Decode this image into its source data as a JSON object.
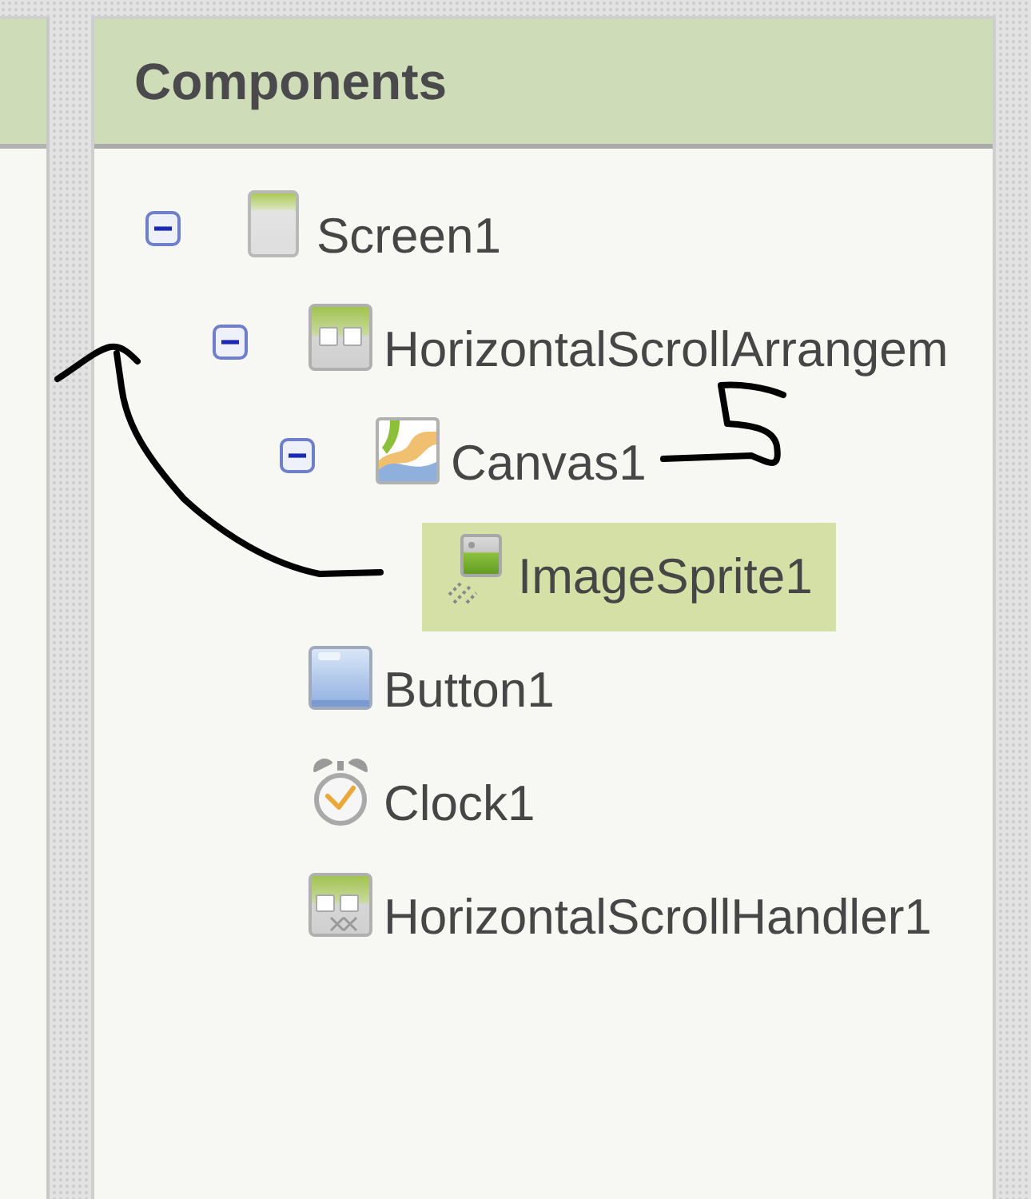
{
  "panel": {
    "title": "Components"
  },
  "tree": [
    {
      "kind": "screen",
      "label": "Screen1",
      "expanded": true,
      "selected": false,
      "children": [
        {
          "kind": "arrangement",
          "label": "HorizontalScrollArrangem",
          "expanded": true,
          "selected": false,
          "children": [
            {
              "kind": "canvas",
              "label": "Canvas1",
              "expanded": true,
              "selected": false,
              "children": [
                {
                  "kind": "sprite",
                  "label": "ImageSprite1",
                  "selected": true
                }
              ]
            }
          ]
        },
        {
          "kind": "button",
          "label": "Button1",
          "selected": false
        },
        {
          "kind": "clock",
          "label": "Clock1",
          "selected": false
        },
        {
          "kind": "scroll_handler",
          "label": "HorizontalScrollHandler1",
          "selected": false
        }
      ]
    }
  ]
}
